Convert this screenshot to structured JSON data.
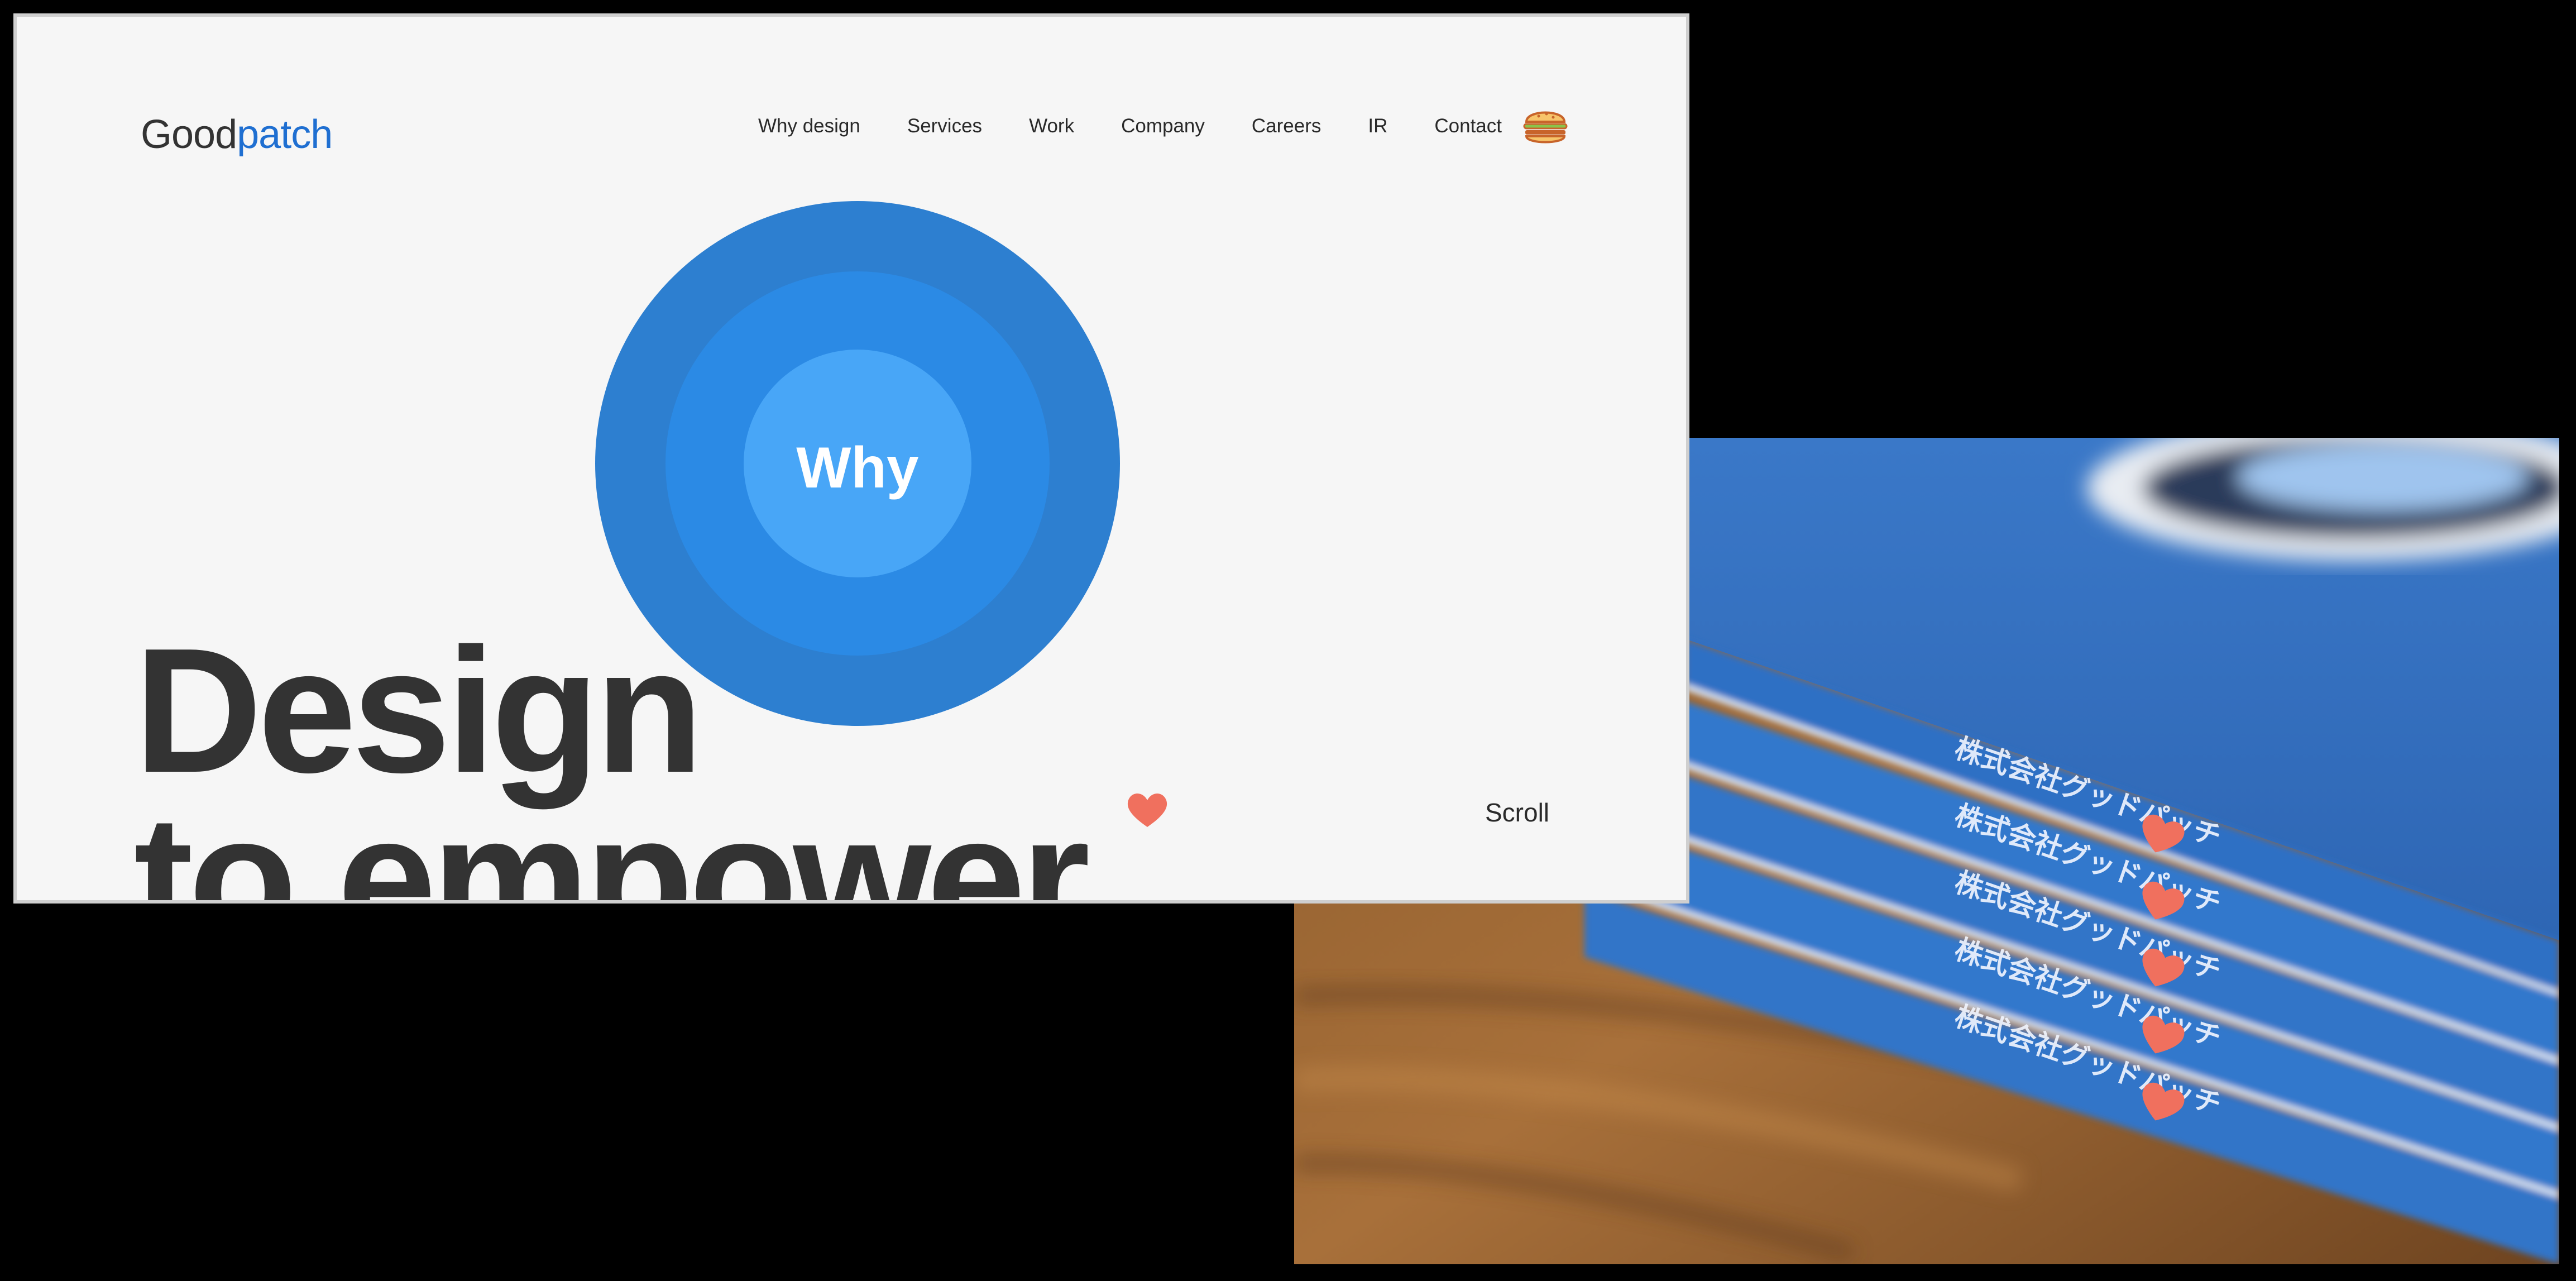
{
  "logo": {
    "part1": "Good",
    "part2": "patch"
  },
  "nav": {
    "items": [
      "Why design",
      "Services",
      "Work",
      "Company",
      "Careers",
      "IR",
      "Contact"
    ]
  },
  "hero": {
    "circle_label": "Why",
    "headline_line1": "Design",
    "headline_line2": "to empower",
    "scroll_label": "Scroll"
  },
  "photo": {
    "spine_text": "株式会社グッドパッチ"
  },
  "colors": {
    "brand_blue": "#1f6fd1",
    "circle_outer": "#2d7fd0",
    "circle_mid": "#2b8ae5",
    "circle_inner": "#48a6f7",
    "heart": "#f0705e",
    "text_dark": "#333333",
    "page_bg": "#f6f6f6"
  },
  "icons": {
    "menu": "hamburger-burger-icon",
    "accent": "heart-icon"
  }
}
